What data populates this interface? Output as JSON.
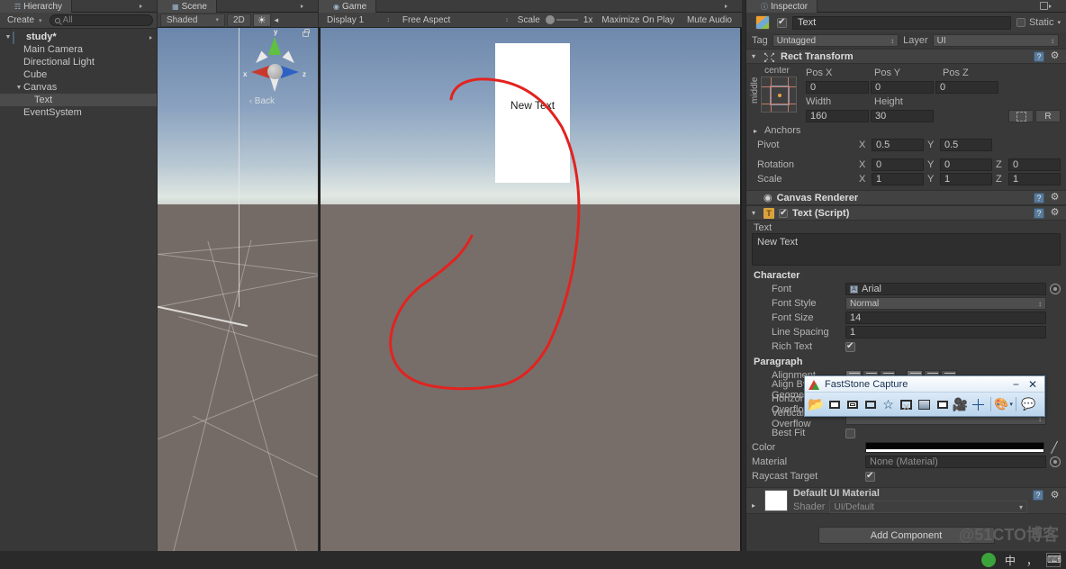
{
  "hierarchy": {
    "tab_label": "Hierarchy",
    "create_label": "Create",
    "search_placeholder": "All",
    "items": [
      {
        "label": "study*",
        "depth": 0,
        "selected": false,
        "root": true,
        "expanded": true
      },
      {
        "label": "Main Camera",
        "depth": 1,
        "selected": false
      },
      {
        "label": "Directional Light",
        "depth": 1,
        "selected": false
      },
      {
        "label": "Cube",
        "depth": 1,
        "selected": false
      },
      {
        "label": "Canvas",
        "depth": 1,
        "selected": false,
        "expanded": true
      },
      {
        "label": "Text",
        "depth": 2,
        "selected": true
      },
      {
        "label": "EventSystem",
        "depth": 1,
        "selected": false
      }
    ]
  },
  "scene": {
    "tab_label": "Scene",
    "shading_mode": "Shaded",
    "mode_2d": "2D",
    "lighting_icon": "sun-icon",
    "audio_icon": "speaker-icon",
    "gizmo": {
      "axis_x": "x",
      "axis_y": "y",
      "axis_z": "z",
      "view_label": "Back"
    }
  },
  "game": {
    "tab_label": "Game",
    "display": "Display 1",
    "aspect": "Free Aspect",
    "scale_label": "Scale",
    "scale_value": "1x",
    "maximize_on_play": "Maximize On Play",
    "mute_audio": "Mute Audio",
    "canvas_text": "New Text"
  },
  "inspector": {
    "tab_label": "Inspector",
    "object_name": "Text",
    "object_enabled": true,
    "static_label": "Static",
    "tag_label": "Tag",
    "tag_value": "Untagged",
    "layer_label": "Layer",
    "layer_value": "UI",
    "rect_transform": {
      "title": "Rect Transform",
      "anchor_h": "center",
      "anchor_v": "middle",
      "pos_x_label": "Pos X",
      "pos_y_label": "Pos Y",
      "pos_z_label": "Pos Z",
      "pos_x": "0",
      "pos_y": "0",
      "pos_z": "0",
      "width_label": "Width",
      "height_label": "Height",
      "width": "160",
      "height": "30",
      "blueprint_label": "",
      "raw_label": "R",
      "anchors_label": "Anchors",
      "pivot_label": "Pivot",
      "pivot_x": "0.5",
      "pivot_y": "0.5",
      "rotation_label": "Rotation",
      "rot_x": "0",
      "rot_y": "0",
      "rot_z": "0",
      "scale_label": "Scale",
      "scale_x": "1",
      "scale_y": "1",
      "scale_z": "1"
    },
    "canvas_renderer": {
      "title": "Canvas Renderer"
    },
    "text_script": {
      "title": "Text (Script)",
      "enabled": true,
      "text_label": "Text",
      "text_value": "New Text",
      "character_label": "Character",
      "font_label": "Font",
      "font_value": "Arial",
      "font_style_label": "Font Style",
      "font_style_value": "Normal",
      "font_size_label": "Font Size",
      "font_size_value": "14",
      "line_spacing_label": "Line Spacing",
      "line_spacing_value": "1",
      "rich_text_label": "Rich Text",
      "rich_text_value": true,
      "paragraph_label": "Paragraph",
      "alignment_label": "Alignment",
      "align_by_geometry_label": "Align By Geometry",
      "horizontal_overflow_label": "Horizontal Overflow",
      "vertical_overflow_label": "Vertical Overflow",
      "best_fit_label": "Best Fit",
      "color_label": "Color",
      "color_value": "#000000",
      "material_label": "Material",
      "material_value": "None (Material)",
      "raycast_target_label": "Raycast Target",
      "raycast_target_value": true
    },
    "material": {
      "title": "Default UI Material",
      "shader_label": "Shader",
      "shader_value": "UI/Default"
    },
    "add_component_label": "Add Component",
    "watermark": "@51CTO博客"
  },
  "faststone": {
    "title": "FastStone Capture",
    "minimize_icon": "minimize-icon",
    "close_icon": "close-icon",
    "tools": [
      "open-file-icon",
      "capture-active-window-icon",
      "capture-window-object-icon",
      "capture-rectangle-icon",
      "capture-freehand-icon",
      "capture-fullscreen-icon",
      "capture-scrolling-window-icon",
      "capture-fixed-region-icon",
      "screen-recorder-icon",
      "screen-magnifier-icon",
      "palette-icon",
      "output-icon"
    ]
  }
}
